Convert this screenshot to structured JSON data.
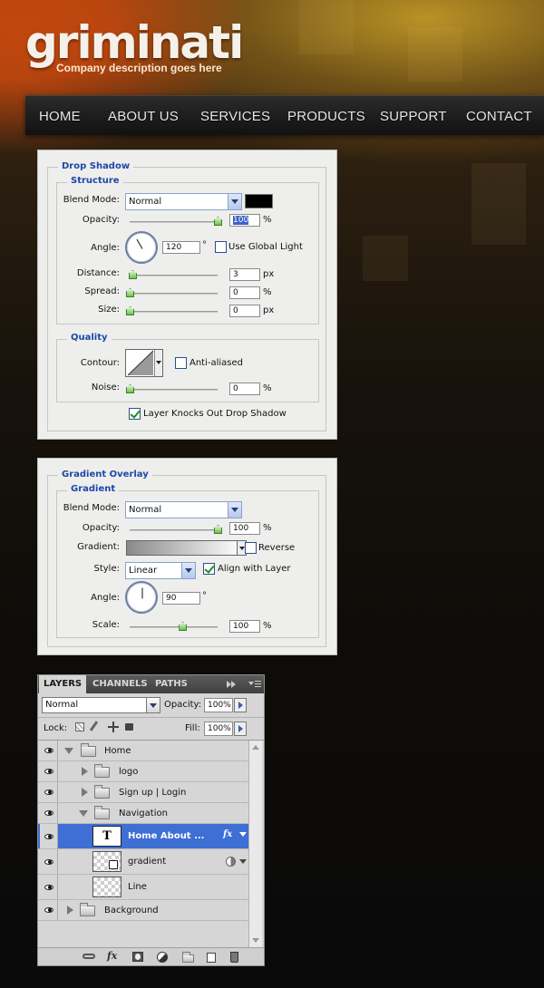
{
  "site": {
    "logo": "griminati",
    "tagline": "Company description goes here",
    "nav": [
      "HOME",
      "ABOUT US",
      "SERVICES",
      "PRODUCTS",
      "SUPPORT",
      "CONTACT"
    ]
  },
  "drop_shadow": {
    "title": "Drop Shadow",
    "structure": {
      "title": "Structure",
      "blend_mode_label": "Blend Mode:",
      "blend_mode": "Normal",
      "color": "#000000",
      "opacity_label": "Opacity:",
      "opacity": "100",
      "opacity_level": 1.0,
      "angle_label": "Angle:",
      "angle": "120",
      "degree": "°",
      "use_global_light": "Use Global Light",
      "use_global_light_checked": false,
      "distance_label": "Distance:",
      "distance": "3",
      "distance_level": 0.03,
      "spread_label": "Spread:",
      "spread": "0",
      "size_label": "Size:",
      "size": "0",
      "unit_px": "px",
      "unit_pct": "%"
    },
    "quality": {
      "title": "Quality",
      "contour_label": "Contour:",
      "anti_aliased": "Anti-aliased",
      "anti_aliased_checked": false,
      "noise_label": "Noise:",
      "noise": "0"
    },
    "knocks_out": "Layer Knocks Out Drop Shadow",
    "knocks_out_checked": true
  },
  "gradient_overlay": {
    "title": "Gradient Overlay",
    "group_title": "Gradient",
    "blend_mode_label": "Blend Mode:",
    "blend_mode": "Normal",
    "opacity_label": "Opacity:",
    "opacity": "100",
    "opacity_level": 1.0,
    "gradient_label": "Gradient:",
    "reverse": "Reverse",
    "reverse_checked": false,
    "style_label": "Style:",
    "style": "Linear",
    "align_with_layer": "Align with Layer",
    "align_checked": true,
    "angle_label": "Angle:",
    "angle": "90",
    "degree": "°",
    "scale_label": "Scale:",
    "scale": "100",
    "scale_level": 0.6,
    "unit_pct": "%"
  },
  "layers_panel": {
    "tabs": [
      "LAYERS",
      "CHANNELS",
      "PATHS"
    ],
    "blend_mode": "Normal",
    "opacity_label": "Opacity:",
    "opacity": "100%",
    "lock_label": "Lock:",
    "fill_label": "Fill:",
    "fill": "100%",
    "layers": [
      {
        "name": "Home",
        "type": "group",
        "expanded": true
      },
      {
        "name": "logo",
        "type": "group",
        "expanded": false
      },
      {
        "name": "Sign up  |  Login",
        "type": "group",
        "expanded": false
      },
      {
        "name": "Navigation",
        "type": "group",
        "expanded": true
      },
      {
        "name": "Home        About ...",
        "type": "text",
        "selected": true
      },
      {
        "name": "gradient",
        "type": "layer"
      },
      {
        "name": "Line",
        "type": "layer"
      },
      {
        "name": "Background",
        "type": "group",
        "expanded": false
      }
    ],
    "text_thumb": "T",
    "fx": "fx"
  }
}
